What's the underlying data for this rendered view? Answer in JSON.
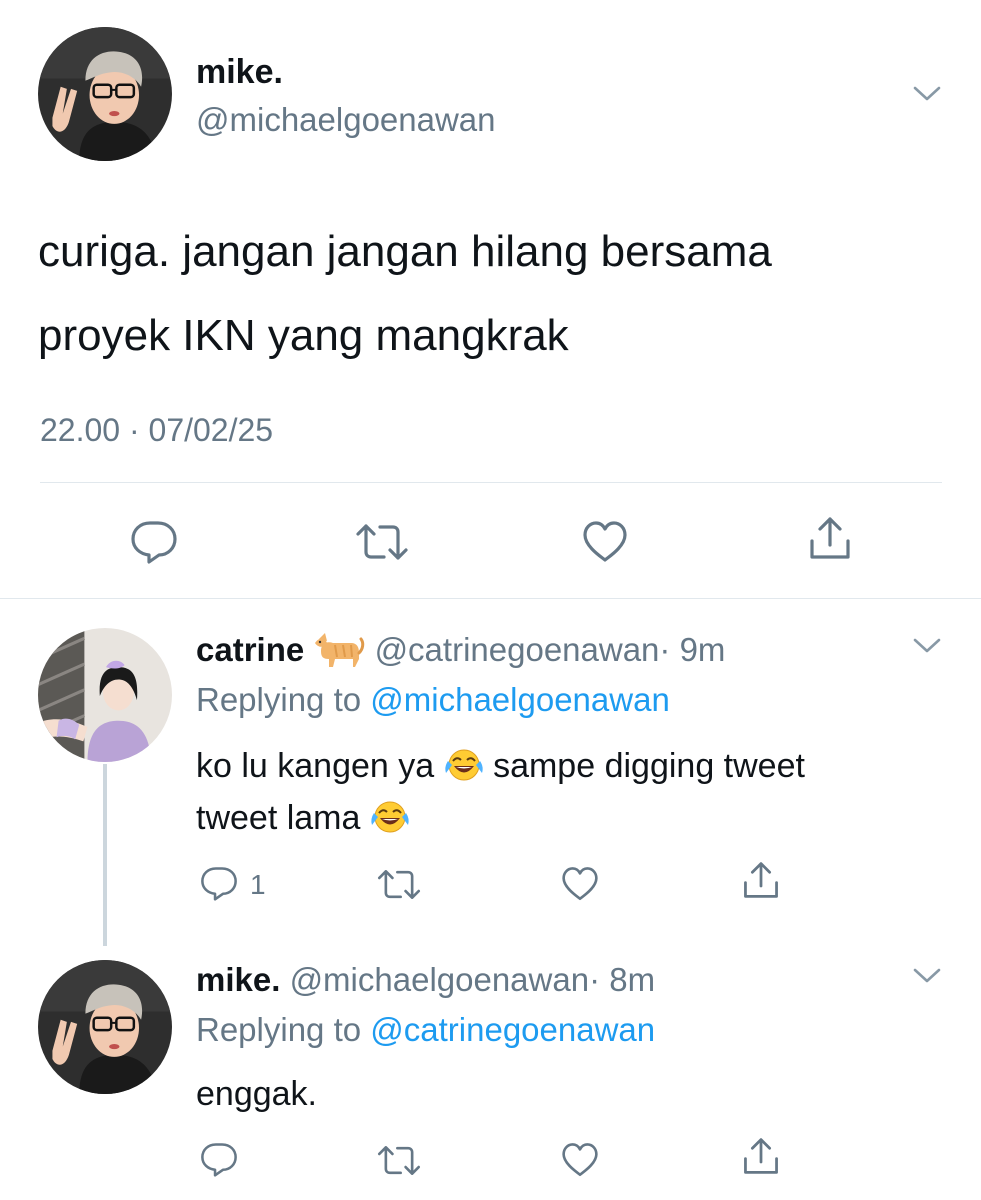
{
  "main_tweet": {
    "author_name": "mike.",
    "handle": "@michaelgoenawan",
    "text_line1": "curiga. jangan jangan hilang bersama",
    "text_line2": "proyek IKN yang mangkrak",
    "timestamp": "22.00 · 07/02/25"
  },
  "reply1": {
    "author_name": "catrine",
    "name_emoji": "cat-emoji",
    "handle": "@catrinegoenawan",
    "time": "· 9m",
    "replying_prefix": "Replying to",
    "replying_handle": "@michaelgoenawan",
    "text_part1": "ko lu kangen ya",
    "text_part2": "sampe digging tweet",
    "text_part3": "tweet lama",
    "reply_count": "1"
  },
  "reply2": {
    "author_name": "mike.",
    "handle": "@michaelgoenawan",
    "time": "· 8m",
    "replying_prefix": "Replying to",
    "replying_handle": "@catrinegoenawan",
    "text": "enggak."
  },
  "colors": {
    "text": "#0f1419",
    "muted": "#657786",
    "link": "#1d9bf0",
    "divider": "#e1e8ed"
  },
  "icons": [
    "reply-icon",
    "retweet-icon",
    "like-icon",
    "share-icon",
    "chevron-down-icon",
    "face-with-tears-of-joy-emoji"
  ]
}
